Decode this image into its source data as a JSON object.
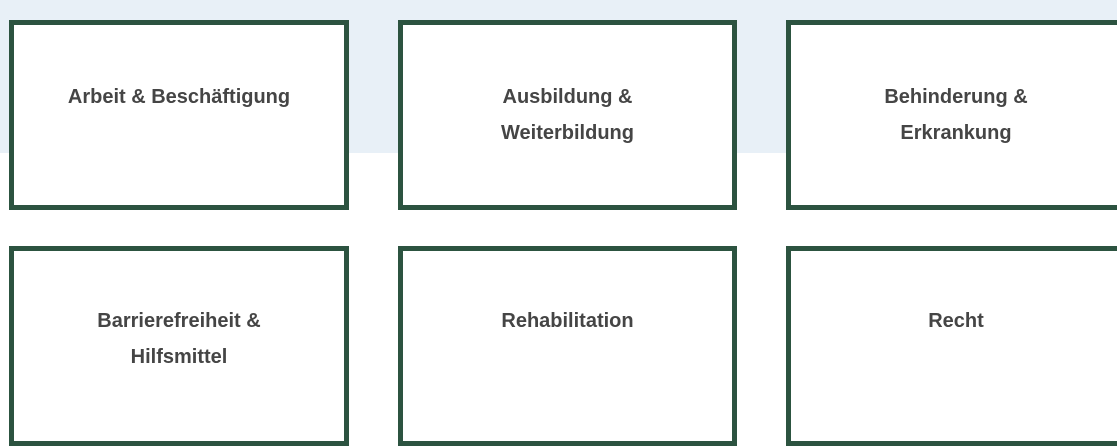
{
  "colors": {
    "band_background": "#e8f0f7",
    "tile_border": "#2c5340",
    "tile_text": "#454545",
    "page_background": "#ffffff"
  },
  "categories": [
    {
      "label": "Arbeit & Beschäftigung"
    },
    {
      "label": "Ausbildung &\nWeiterbildung"
    },
    {
      "label": "Behinderung &\nErkrankung"
    },
    {
      "label": "Barrierefreiheit &\nHilfsmittel"
    },
    {
      "label": "Rehabilitation"
    },
    {
      "label": "Recht"
    }
  ]
}
